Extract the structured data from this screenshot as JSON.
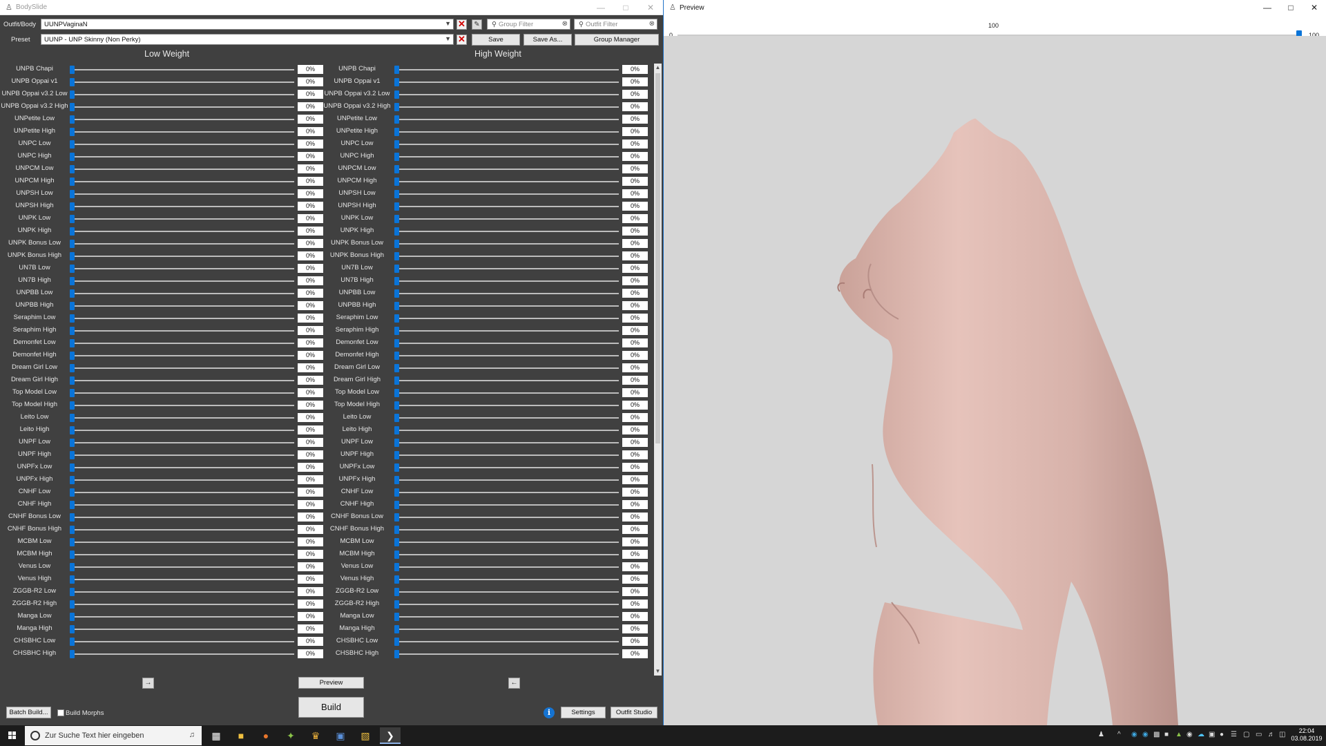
{
  "bodyslide": {
    "title": "BodySlide",
    "outfit_label": "Outfit/Body",
    "outfit_value": "UUNPVaginaN",
    "preset_label": "Preset",
    "preset_value": "UUNP - UNP Skinny (Non Perky)",
    "group_filter_placeholder": "Group Filter",
    "outfit_filter_placeholder": "Outfit Filter",
    "save_label": "Save",
    "save_as_label": "Save As...",
    "group_manager_label": "Group Manager",
    "low_weight_heading": "Low Weight",
    "high_weight_heading": "High Weight",
    "sliders": [
      "UNPB Chapi",
      "UNPB Oppai v1",
      "UNPB Oppai v3.2 Low",
      "UNPB Oppai v3.2 High",
      "UNPetite Low",
      "UNPetite High",
      "UNPC Low",
      "UNPC High",
      "UNPCM Low",
      "UNPCM High",
      "UNPSH Low",
      "UNPSH High",
      "UNPK Low",
      "UNPK High",
      "UNPK Bonus Low",
      "UNPK Bonus High",
      "UN7B Low",
      "UN7B High",
      "UNPBB Low",
      "UNPBB High",
      "Seraphim Low",
      "Seraphim High",
      "Demonfet Low",
      "Demonfet High",
      "Dream Girl Low",
      "Dream Girl High",
      "Top Model Low",
      "Top Model High",
      "Leito Low",
      "Leito High",
      "UNPF Low",
      "UNPF High",
      "UNPFx Low",
      "UNPFx High",
      "CNHF Low",
      "CNHF High",
      "CNHF Bonus Low",
      "CNHF Bonus High",
      "MCBM Low",
      "MCBM High",
      "Venus Low",
      "Venus High",
      "ZGGB-R2 Low",
      "ZGGB-R2 High",
      "Manga Low",
      "Manga High",
      "CHSBHC Low",
      "CHSBHC High"
    ],
    "slider_value": "0%",
    "arrow_right": "→",
    "arrow_left": "←",
    "preview_label": "Preview",
    "build_label": "Build",
    "batch_build_label": "Batch Build...",
    "build_morphs_label": "Build Morphs",
    "settings_label": "Settings",
    "outfit_studio_label": "Outfit Studio"
  },
  "preview": {
    "title": "Preview",
    "weight_min": "0",
    "weight_max": "100",
    "weight_current": "100",
    "weight_fraction": 1.0
  },
  "taskbar": {
    "search_placeholder": "Zur Suche Text hier eingeben",
    "time": "22:04",
    "date": "03.08.2019"
  },
  "colors": {
    "panel_bg": "#404040",
    "slider_accent": "#0a74d8",
    "close_red": "#d10000",
    "preview_bg": "#d6d6d6",
    "skin": "#ddb5ad",
    "taskbar_bg": "#1c1c1c"
  },
  "icons": {
    "window_icon": "bodyslide-icon",
    "filter": "funnel-icon",
    "clear": "clear-circle-icon",
    "remove": "red-x-icon",
    "info": "info-icon"
  }
}
